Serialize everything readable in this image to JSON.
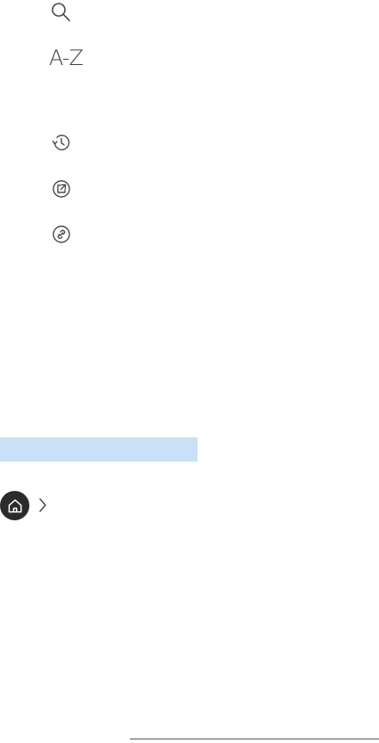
{
  "icons": {
    "search": "search-icon",
    "az_sort": "A-Z",
    "history": "history-icon",
    "external_link": "external-link-icon",
    "link": "link-icon",
    "home": "home-icon",
    "chevron": "chevron-right-icon"
  },
  "colors": {
    "highlight": "#c9e0f6",
    "home_button_bg": "#2b2b2b",
    "icon_stroke": "#4a4a4a"
  }
}
